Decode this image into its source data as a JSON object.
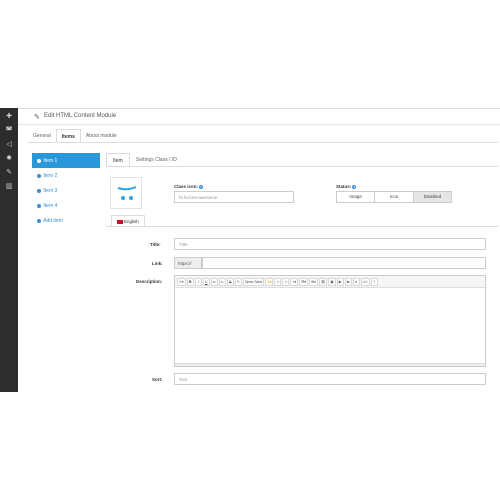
{
  "header": {
    "title": "Edit HTML Content Module"
  },
  "main_tabs": [
    {
      "label": "General"
    },
    {
      "label": "Items"
    },
    {
      "label": "About module"
    }
  ],
  "items": [
    {
      "label": "Item 1"
    },
    {
      "label": "Item 2"
    },
    {
      "label": "Item 3"
    },
    {
      "label": "Item 4"
    },
    {
      "label": "Add item"
    }
  ],
  "sub_tabs": [
    {
      "label": "Item"
    },
    {
      "label": "Settings Class / ID"
    }
  ],
  "class_icon": {
    "label": "Class icon:",
    "placeholder": "fa fa-font-awesome"
  },
  "status": {
    "label": "Status:",
    "options": [
      "Image",
      "Icon",
      "Disabled"
    ]
  },
  "language_tab": {
    "label": "English"
  },
  "fields": {
    "title_label": "Title:",
    "title_placeholder": "Title",
    "link_label": "Link:",
    "link_prefix": "https://",
    "description_label": "Description:",
    "sort_label": "Sort:",
    "sort_placeholder": "Sort"
  },
  "editor_toolbar": {
    "font_family": "Open Sans",
    "buttons": [
      "✐▾",
      "B",
      "I",
      "U",
      "x²",
      "x₂",
      "S",
      "✎",
      "A▾",
      "≡",
      "≡",
      "≡▾",
      "☰▾",
      "⊞▾",
      "⛓",
      "▣",
      "▶",
      "⇆",
      "✕",
      "</>",
      "?"
    ]
  },
  "colors": {
    "accent": "#2a97d8",
    "sidebar": "#2d2d2d"
  }
}
